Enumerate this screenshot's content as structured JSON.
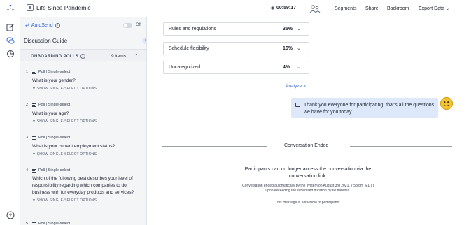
{
  "app": {
    "title": "Life Since Pandemic",
    "timer": "00:59:17"
  },
  "topnav": {
    "segments": "Segments",
    "share": "Share",
    "backroom": "Backroom",
    "export": "Export Data"
  },
  "icons": {
    "logo": "dots-logo-icon",
    "title": "conversation-icon",
    "people": "people-icon",
    "rail": [
      "edit-icon",
      "chat-icon",
      "chart-icon",
      "help-icon"
    ]
  },
  "colors": {
    "accent": "#2f64d8",
    "bot_message_bg": "#dde9fb",
    "sidebar_bg": "#f4f5f7"
  },
  "sidebar": {
    "autosend_label": "AutoSend",
    "toggle_state": "Off",
    "guide_title": "Discussion Guide",
    "polls_title": "ONBOARDING POLLS",
    "polls_count": "9 items",
    "polls": [
      {
        "num": "1",
        "type": "Poll | Single-select",
        "question": "What is your gender?",
        "options": "▼ SHOW SINGLE-SELECT OPTIONS"
      },
      {
        "num": "2",
        "type": "Poll | Single-select",
        "question": "What is your age?",
        "options": "▼ SHOW SINGLE-SELECT OPTIONS"
      },
      {
        "num": "3",
        "type": "Poll | Single-select",
        "question": "What is your current employment status?",
        "options": "▼ SHOW SINGLE-SELECT OPTIONS"
      },
      {
        "num": "4",
        "type": "Poll | Single-select",
        "question": "Which of the following best describes your level of responsibility regarding which companies to do business with for everyday products and services?",
        "options": "▼ SHOW SINGLE-SELECT OPTIONS"
      },
      {
        "num": "5",
        "type": "Poll | Single-select"
      }
    ]
  },
  "main": {
    "bars": [
      {
        "label": "Rules and regulations",
        "pct": "35%"
      },
      {
        "label": "Schedule flexibility",
        "pct": "16%"
      },
      {
        "label": "Uncategorized",
        "pct": "4%"
      }
    ],
    "analyze": "Analyze >",
    "bot_message": "Thank you everyone for participating, that's all the questions we have for you today.",
    "conversation_ended": "Conversation Ended",
    "ended_main": "Participants can no longer access the conversation via the conversation link.",
    "ended_detail": "Conversation ended automatically by the system on August 3rd 2021, 7:58 pm (EDT) upon exceeding the scheduled duration by 60 minutes.",
    "ended_note": "This message is not visible to participants."
  }
}
